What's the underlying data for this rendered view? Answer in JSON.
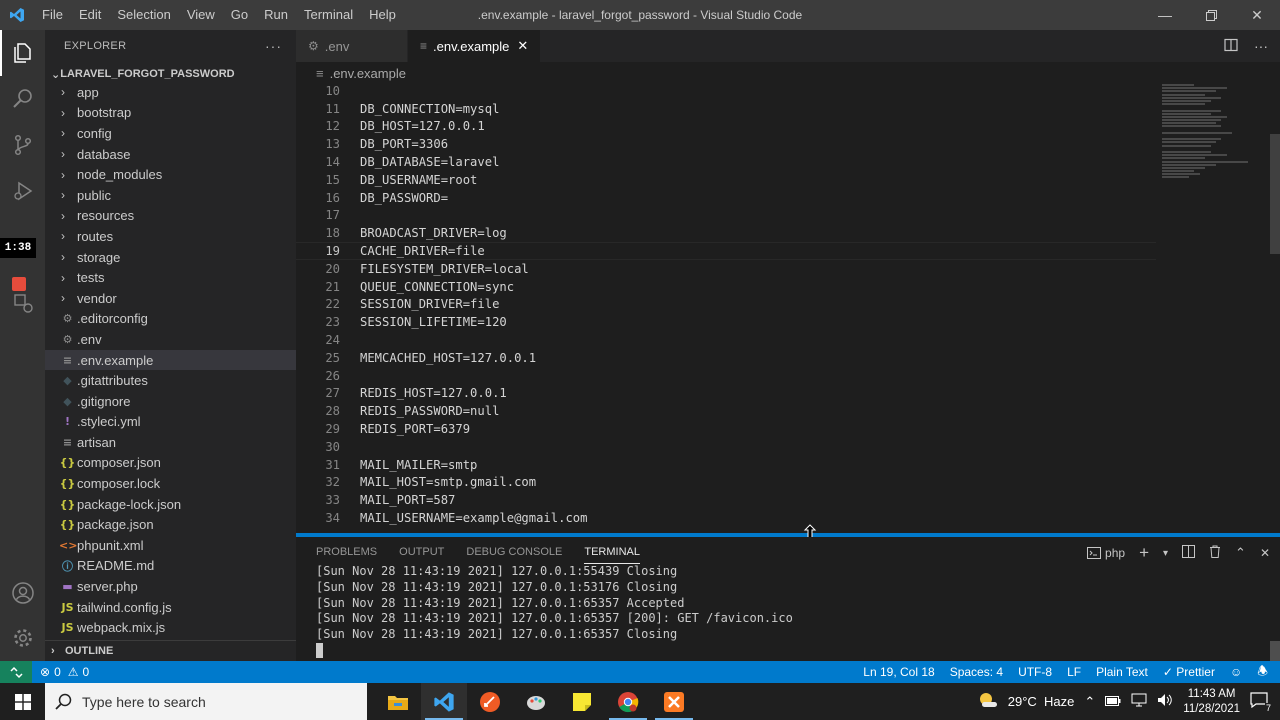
{
  "titlebar": {
    "menu": [
      "File",
      "Edit",
      "Selection",
      "View",
      "Go",
      "Run",
      "Terminal",
      "Help"
    ],
    "title": ".env.example - laravel_forgot_password - Visual Studio Code"
  },
  "activity": {
    "timer": "1:38"
  },
  "explorer": {
    "header": "EXPLORER",
    "project": "LARAVEL_FORGOT_PASSWORD",
    "folders": [
      "app",
      "bootstrap",
      "config",
      "database",
      "node_modules",
      "public",
      "resources",
      "routes",
      "storage",
      "tests",
      "vendor"
    ],
    "files": [
      {
        "name": ".editorconfig",
        "icon": "⚙",
        "color": "#8f8f8f"
      },
      {
        "name": ".env",
        "icon": "⚙",
        "color": "#8f8f8f"
      },
      {
        "name": ".env.example",
        "icon": "≡",
        "color": "#8f8f8f"
      },
      {
        "name": ".gitattributes",
        "icon": "◆",
        "color": "#41535b"
      },
      {
        "name": ".gitignore",
        "icon": "◆",
        "color": "#41535b"
      },
      {
        "name": ".styleci.yml",
        "icon": "!",
        "color": "#a074c4"
      },
      {
        "name": "artisan",
        "icon": "≡",
        "color": "#8f8f8f"
      },
      {
        "name": "composer.json",
        "icon": "{}",
        "color": "#cbcb41"
      },
      {
        "name": "composer.lock",
        "icon": "{}",
        "color": "#cbcb41"
      },
      {
        "name": "package-lock.json",
        "icon": "{}",
        "color": "#cbcb41"
      },
      {
        "name": "package.json",
        "icon": "{}",
        "color": "#cbcb41"
      },
      {
        "name": "phpunit.xml",
        "icon": "<>",
        "color": "#e37933"
      },
      {
        "name": "README.md",
        "icon": "ⓘ",
        "color": "#519aba"
      },
      {
        "name": "server.php",
        "icon": "▬",
        "color": "#a074c4"
      },
      {
        "name": "tailwind.config.js",
        "icon": "JS",
        "color": "#cbcb41"
      },
      {
        "name": "webpack.mix.js",
        "icon": "JS",
        "color": "#cbcb41"
      }
    ],
    "selected": ".env.example",
    "outline": "OUTLINE"
  },
  "tabs": [
    {
      "label": ".env",
      "icon": "⚙",
      "active": false
    },
    {
      "label": ".env.example",
      "icon": "≡",
      "active": true
    }
  ],
  "breadcrumb": ".env.example",
  "editor": {
    "cursor_line": 19,
    "lines": [
      {
        "n": "10",
        "t": ""
      },
      {
        "n": "11",
        "t": "DB_CONNECTION=mysql"
      },
      {
        "n": "12",
        "t": "DB_HOST=127.0.0.1"
      },
      {
        "n": "13",
        "t": "DB_PORT=3306"
      },
      {
        "n": "14",
        "t": "DB_DATABASE=laravel"
      },
      {
        "n": "15",
        "t": "DB_USERNAME=root"
      },
      {
        "n": "16",
        "t": "DB_PASSWORD="
      },
      {
        "n": "17",
        "t": ""
      },
      {
        "n": "18",
        "t": "BROADCAST_DRIVER=log"
      },
      {
        "n": "19",
        "t": "CACHE_DRIVER=file"
      },
      {
        "n": "20",
        "t": "FILESYSTEM_DRIVER=local"
      },
      {
        "n": "21",
        "t": "QUEUE_CONNECTION=sync"
      },
      {
        "n": "22",
        "t": "SESSION_DRIVER=file"
      },
      {
        "n": "23",
        "t": "SESSION_LIFETIME=120"
      },
      {
        "n": "24",
        "t": ""
      },
      {
        "n": "25",
        "t": "MEMCACHED_HOST=127.0.0.1"
      },
      {
        "n": "26",
        "t": ""
      },
      {
        "n": "27",
        "t": "REDIS_HOST=127.0.0.1"
      },
      {
        "n": "28",
        "t": "REDIS_PASSWORD=null"
      },
      {
        "n": "29",
        "t": "REDIS_PORT=6379"
      },
      {
        "n": "30",
        "t": ""
      },
      {
        "n": "31",
        "t": "MAIL_MAILER=smtp"
      },
      {
        "n": "32",
        "t": "MAIL_HOST=smtp.gmail.com"
      },
      {
        "n": "33",
        "t": "MAIL_PORT=587"
      },
      {
        "n": "34",
        "t": "MAIL_USERNAME=example@gmail.com"
      }
    ]
  },
  "panel": {
    "tabs": [
      "PROBLEMS",
      "OUTPUT",
      "DEBUG CONSOLE",
      "TERMINAL"
    ],
    "active_tab": "TERMINAL",
    "shell": "php",
    "terminal_lines": [
      "[Sun Nov 28 11:43:19 2021] 127.0.0.1:55439 Closing",
      "[Sun Nov 28 11:43:19 2021] 127.0.0.1:53176 Closing",
      "[Sun Nov 28 11:43:19 2021] 127.0.0.1:65357 Accepted",
      "[Sun Nov 28 11:43:19 2021] 127.0.0.1:65357 [200]: GET /favicon.ico",
      "[Sun Nov 28 11:43:19 2021] 127.0.0.1:65357 Closing"
    ]
  },
  "status": {
    "errors": "0",
    "warnings": "0",
    "position": "Ln 19, Col 18",
    "spaces": "Spaces: 4",
    "encoding": "UTF-8",
    "eol": "LF",
    "language": "Plain Text",
    "prettier": "Prettier"
  },
  "taskbar": {
    "search_placeholder": "Type here to search",
    "weather": "29°C  Haze",
    "time": "11:43 AM",
    "date": "11/28/2021",
    "notifications": "7"
  },
  "colors": {
    "accent": "#007acc",
    "statusbar": "#007acc",
    "remote": "#16825d",
    "titlebar": "#3c3c3c",
    "sidebar": "#252526",
    "editor": "#1e1e1e"
  }
}
